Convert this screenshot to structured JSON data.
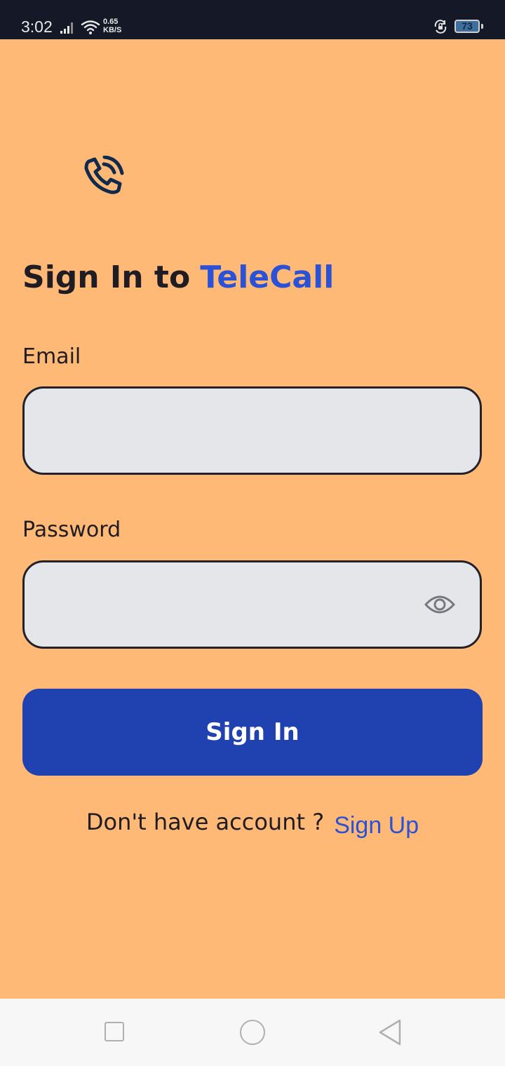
{
  "status_bar": {
    "time": "3:02",
    "net_speed_value": "0.65",
    "net_speed_unit": "KB/S",
    "battery_level": "73",
    "icons": [
      "signal-icon",
      "wifi-icon",
      "rotate-lock-icon",
      "battery-icon"
    ]
  },
  "login": {
    "logo_icon": "phone-call-icon",
    "title_prefix": "Sign In to",
    "brand_name": "TeleCall",
    "email": {
      "label": "Email",
      "value": "",
      "placeholder": ""
    },
    "password": {
      "label": "Password",
      "value": "",
      "placeholder": "",
      "toggle_icon": "eye-icon"
    },
    "submit_label": "Sign In",
    "signup_prompt": "Don't have account ?",
    "signup_link": "Sign Up"
  },
  "nav_bar": {
    "icons": [
      "recent-apps-icon",
      "home-icon",
      "back-icon"
    ]
  },
  "colors": {
    "background": "#fdb975",
    "status_bar": "#151826",
    "title_text": "#201c23",
    "brand_accent": "#2a51d6",
    "input_fill": "#e5e6ea",
    "input_border": "#23212a",
    "button_fill": "#2042b0",
    "button_text": "#ffffff",
    "logo": "#0f2a4d",
    "nav_bar": "#f7f7f7"
  }
}
